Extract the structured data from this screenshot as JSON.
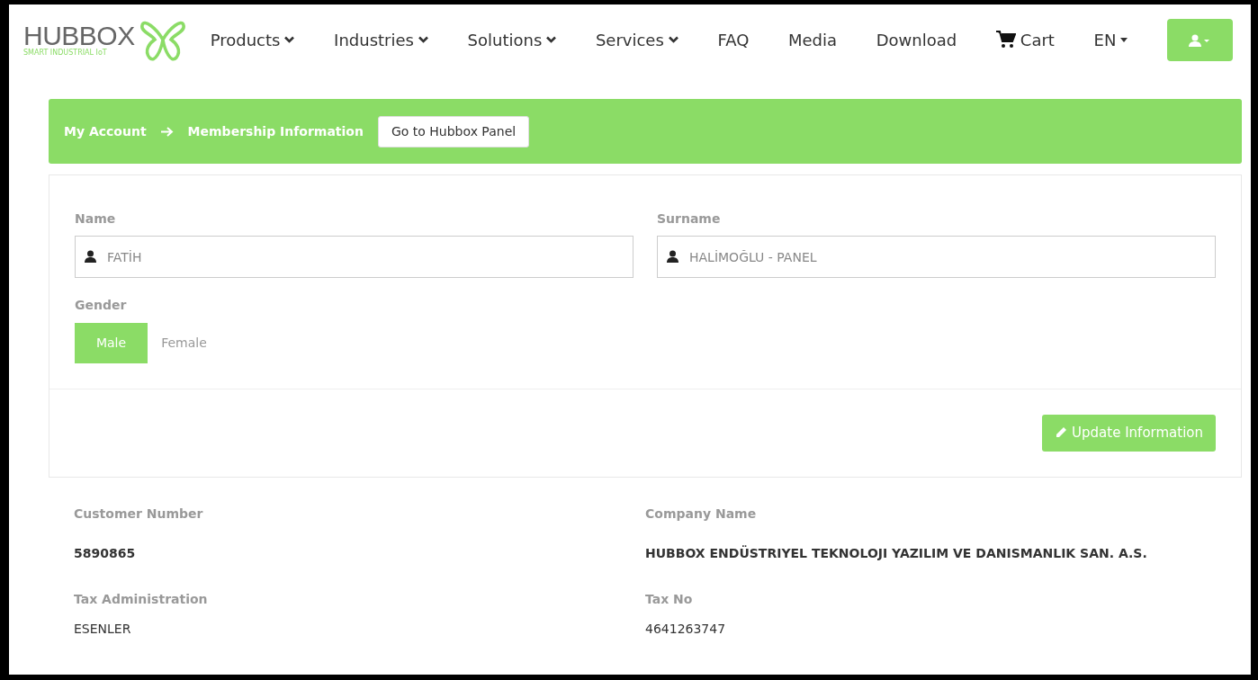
{
  "logo": {
    "name": "HUBBOX",
    "tagline": "SMART INDUSTRIAL IoT"
  },
  "nav": [
    {
      "label": "Products",
      "kind": "dropdown"
    },
    {
      "label": "Industries",
      "kind": "dropdown"
    },
    {
      "label": "Solutions",
      "kind": "dropdown"
    },
    {
      "label": "Services",
      "kind": "dropdown"
    },
    {
      "label": "FAQ",
      "kind": "link"
    },
    {
      "label": "Media",
      "kind": "link"
    },
    {
      "label": "Download",
      "kind": "link"
    }
  ],
  "cart": {
    "label": "Cart"
  },
  "language": {
    "label": "EN"
  },
  "breadcrumb": {
    "items": [
      "My Account",
      "Membership Information"
    ],
    "button": "Go to Hubbox Panel"
  },
  "form": {
    "fields": [
      {
        "label": "Name",
        "value": "FATİH"
      },
      {
        "label": "Surname",
        "value": "HALİMOĞLU - PANEL"
      }
    ],
    "gender": {
      "label": "Gender",
      "options": [
        {
          "label": "Male",
          "selected": true
        },
        {
          "label": "Female",
          "selected": false
        }
      ]
    },
    "submit": "Update Information"
  },
  "info": [
    {
      "label": "Customer Number",
      "value": "5890865",
      "kind": "bold"
    },
    {
      "label": "Company Name",
      "value": "HUBBOX ENDÜSTRIYEL TEKNOLOJI YAZILIM VE DANISMANLIK SAN. A.S.",
      "kind": "bold"
    },
    {
      "label": "Tax Administration",
      "value": "ESENLER",
      "kind": "plain"
    },
    {
      "label": "Tax No",
      "value": "4641263747",
      "kind": "plain"
    }
  ]
}
